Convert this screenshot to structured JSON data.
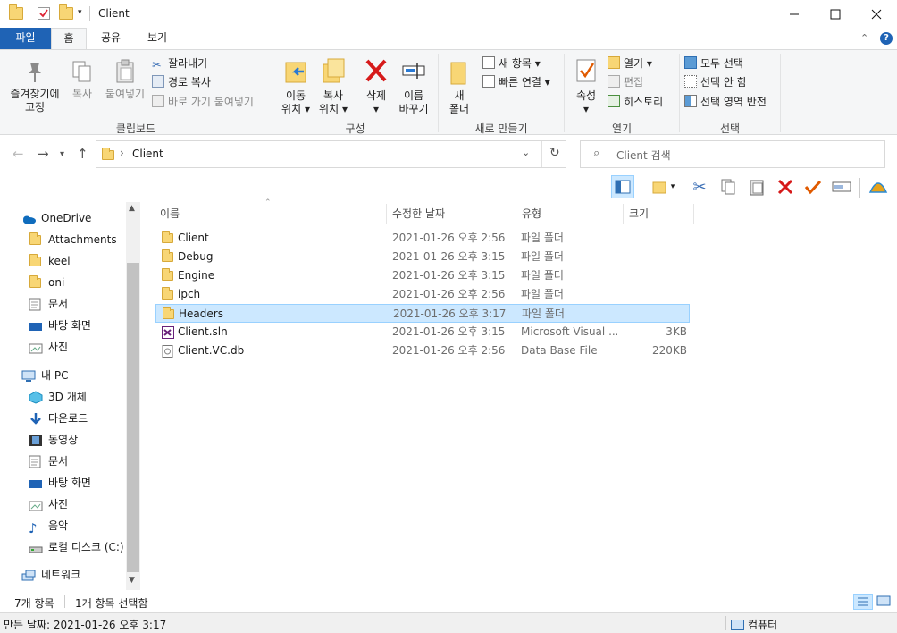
{
  "window": {
    "title": "Client"
  },
  "tabs": {
    "file": "파일",
    "home": "홈",
    "share": "공유",
    "view": "보기"
  },
  "ribbon": {
    "clipboard": {
      "label": "클립보드",
      "pin_line1": "즐겨찾기에",
      "pin_line2": "고정",
      "copy": "복사",
      "paste": "붙여넣기",
      "cut": "잘라내기",
      "copy_path": "경로 복사",
      "paste_shortcut": "바로 가기 붙여넣기"
    },
    "organize": {
      "label": "구성",
      "move_line1": "이동",
      "move_line2": "위치",
      "copy_line1": "복사",
      "copy_line2": "위치",
      "delete": "삭제",
      "rename_line1": "이름",
      "rename_line2": "바꾸기"
    },
    "new": {
      "label": "새로 만들기",
      "folder_line1": "새",
      "folder_line2": "폴더",
      "new_item": "새 항목",
      "easy_access": "빠른 연결"
    },
    "open": {
      "label": "열기",
      "properties": "속성",
      "open": "열기",
      "edit": "편집",
      "history": "히스토리"
    },
    "select": {
      "label": "선택",
      "select_all": "모두 선택",
      "select_none": "선택 안 함",
      "invert": "선택 영역 반전"
    }
  },
  "address": {
    "crumb": "Client",
    "search_placeholder": "Client 검색"
  },
  "nav": {
    "onedrive": "OneDrive",
    "od_items": [
      "Attachments",
      "keel",
      "oni",
      "문서",
      "바탕 화면",
      "사진"
    ],
    "pc": "내 PC",
    "pc_items": [
      "3D 개체",
      "다운로드",
      "동영상",
      "문서",
      "바탕 화면",
      "사진",
      "음악",
      "로컬 디스크 (C:)"
    ],
    "network": "네트워크"
  },
  "columns": {
    "name": "이름",
    "modified": "수정한 날짜",
    "type": "유형",
    "size": "크기"
  },
  "files": [
    {
      "name": "Client",
      "modified": "2021-01-26 오후 2:56",
      "type": "파일 폴더",
      "size": "",
      "icon": "folder-icon"
    },
    {
      "name": "Debug",
      "modified": "2021-01-26 오후 3:15",
      "type": "파일 폴더",
      "size": "",
      "icon": "folder-icon"
    },
    {
      "name": "Engine",
      "modified": "2021-01-26 오후 3:15",
      "type": "파일 폴더",
      "size": "",
      "icon": "folder-icon"
    },
    {
      "name": "ipch",
      "modified": "2021-01-26 오후 2:56",
      "type": "파일 폴더",
      "size": "",
      "icon": "folder-icon"
    },
    {
      "name": "Headers",
      "modified": "2021-01-26 오후 3:17",
      "type": "파일 폴더",
      "size": "",
      "icon": "folder-icon",
      "selected": true
    },
    {
      "name": "Client.sln",
      "modified": "2021-01-26 오후 3:15",
      "type": "Microsoft Visual ...",
      "size": "3KB",
      "icon": "visual-studio-solution-icon"
    },
    {
      "name": "Client.VC.db",
      "modified": "2021-01-26 오후 2:56",
      "type": "Data Base File",
      "size": "220KB",
      "icon": "database-file-icon"
    }
  ],
  "status": {
    "item_count": "7개 항목",
    "selected_count": "1개 항목 선택함",
    "modified_info": "만든 날짜: 2021-01-26 오후 3:17",
    "computer": "컴퓨터"
  },
  "colors": {
    "file_tab": "#1f63b5",
    "selection": "#cce8ff",
    "folder": "#f8d675"
  }
}
